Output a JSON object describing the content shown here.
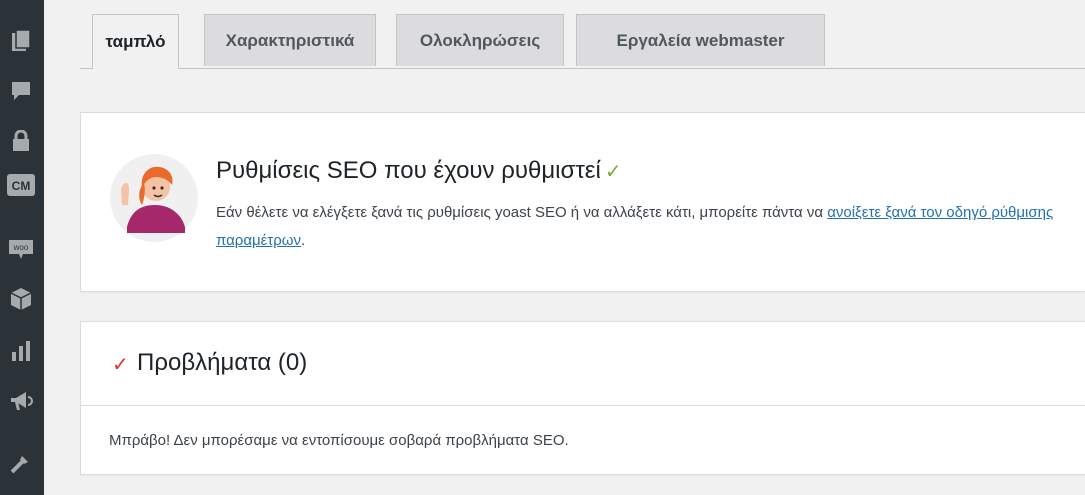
{
  "tabs": [
    {
      "label": "ταμπλό",
      "active": true
    },
    {
      "label": "Χαρακτηριστικά",
      "active": false
    },
    {
      "label": "Ολοκληρώσεις",
      "active": false
    },
    {
      "label": "Εργαλεία webmaster",
      "active": false
    }
  ],
  "sidebar": {
    "icons": [
      "pages-icon",
      "comments-icon",
      "lock-icon",
      "cm-icon",
      "woo-icon",
      "box-icon",
      "analytics-icon",
      "marketing-icon",
      "tools-icon"
    ],
    "cm_label": "CM",
    "woo_label": "woo"
  },
  "setup": {
    "title": "Ρυθμίσεις SEO που έχουν ρυθμιστεί",
    "check": "✓",
    "text_before": "Εάν θέλετε να ελέγξετε ξανά τις ρυθμίσεις yoast SEO ή να αλλάξετε κάτι, μπορείτε πάντα να ",
    "link": "ανοίξετε ξανά τον οδηγό ρύθμισης παραμέτρων",
    "text_after": "."
  },
  "problems": {
    "check": "✓",
    "title": "Προβλήματα (0)",
    "message": "Μπράβο! Δεν μπορέσαμε να εντοπίσουμε σοβαρά προβλήματα SEO."
  },
  "colors": {
    "adminbar": "#2c3338",
    "link": "#2271b1",
    "check_green": "#77b227",
    "check_red": "#dc3232"
  }
}
